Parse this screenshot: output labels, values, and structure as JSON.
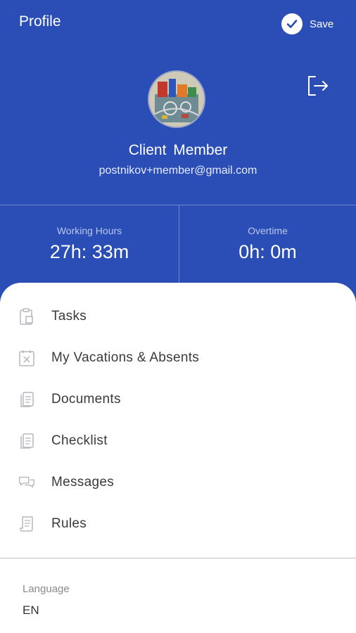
{
  "header": {
    "title": "Profile",
    "save_label": "Save",
    "accent_color": "#2a4eb5"
  },
  "profile": {
    "name": "Client  Member",
    "email": "postnikov+member@gmail.com"
  },
  "stats": {
    "working_hours": {
      "label": "Working Hours",
      "value": "27h: 33m"
    },
    "overtime": {
      "label": "Overtime",
      "value": "0h: 0m"
    }
  },
  "menu": {
    "items": [
      {
        "label": "Tasks",
        "icon": "clipboard-icon"
      },
      {
        "label": "My Vacations & Absents",
        "icon": "calendar-x-icon"
      },
      {
        "label": "Documents",
        "icon": "documents-icon"
      },
      {
        "label": "Checklist",
        "icon": "checklist-icon"
      },
      {
        "label": "Messages",
        "icon": "messages-icon"
      },
      {
        "label": "Rules",
        "icon": "rules-icon"
      }
    ]
  },
  "language": {
    "label": "Language",
    "value": "EN"
  }
}
